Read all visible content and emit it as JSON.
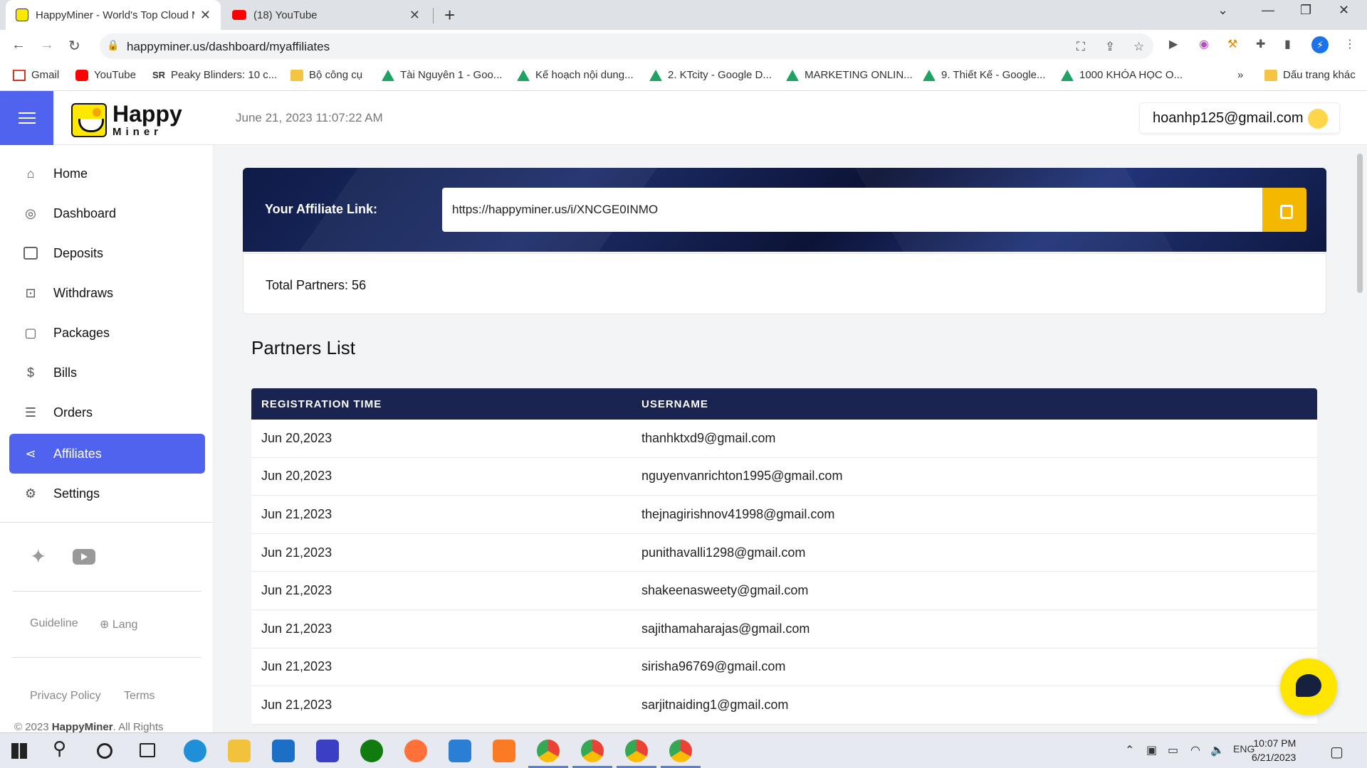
{
  "browser": {
    "tabs": [
      {
        "title": "HappyMiner - World's Top Cloud Mining",
        "active": true
      },
      {
        "title": "(18) YouTube",
        "active": false
      }
    ],
    "url": "happyminer.us/dashboard/myaffiliates",
    "bookmarks": [
      "Gmail",
      "YouTube",
      "Peaky Blinders: 10 c...",
      "Bộ công cụ",
      "Tài Nguyên 1 - Goo...",
      "Kế hoạch nội dung...",
      "2. KTcity - Google D...",
      "MARKETING ONLIN...",
      "9. Thiết Kế - Google...",
      "1000 KHÓA HỌC O...",
      "Dấu trang khác"
    ],
    "bookmarks_more": "»"
  },
  "header": {
    "logo_line1": "Happy",
    "logo_line2": "Miner",
    "datetime": "June 21, 2023 11:07:22 AM",
    "user_email": "hoanhp125@gmail.com"
  },
  "sidebar": {
    "items": [
      {
        "label": "Home",
        "icon": "home-icon"
      },
      {
        "label": "Dashboard",
        "icon": "compass-icon"
      },
      {
        "label": "Deposits",
        "icon": "wallet-icon"
      },
      {
        "label": "Withdraws",
        "icon": "cash-icon"
      },
      {
        "label": "Packages",
        "icon": "bag-icon"
      },
      {
        "label": "Bills",
        "icon": "bill-icon"
      },
      {
        "label": "Orders",
        "icon": "orders-icon"
      },
      {
        "label": "Affiliates",
        "icon": "share-icon",
        "active": true
      },
      {
        "label": "Settings",
        "icon": "gear-icon"
      }
    ],
    "guideline": "Guideline",
    "lang": "Lang",
    "privacy": "Privacy Policy",
    "terms": "Terms",
    "copyright_prefix": "© 2023",
    "copyright_brand": "HappyMiner",
    "copyright_suffix": ". All Rights"
  },
  "affiliate": {
    "label": "Your Affiliate Link:",
    "link": "https://happyminer.us/i/XNCGE0INMO",
    "total_partners": "Total Partners: 56"
  },
  "partners": {
    "title": "Partners List",
    "columns": [
      "REGISTRATION TIME",
      "USERNAME"
    ],
    "rows": [
      [
        "Jun 20,2023",
        "thanhktxd9@gmail.com"
      ],
      [
        "Jun 20,2023",
        "nguyenvanrichton1995@gmail.com"
      ],
      [
        "Jun 21,2023",
        "thejnagirishnov41998@gmail.com"
      ],
      [
        "Jun 21,2023",
        "punithavalli1298@gmail.com"
      ],
      [
        "Jun 21,2023",
        "shakeenasweety@gmail.com"
      ],
      [
        "Jun 21,2023",
        "sajithamaharajas@gmail.com"
      ],
      [
        "Jun 21,2023",
        "sirisha96769@gmail.com"
      ],
      [
        "Jun 21,2023",
        "sarjitnaiding1@gmail.com"
      ]
    ]
  },
  "taskbar": {
    "lang": "ENG",
    "time": "10:07 PM",
    "date": "6/21/2023"
  },
  "colors": {
    "accent": "#4f63ef",
    "banner": "#0f1b47",
    "copy_button": "#f5b800",
    "table_header": "#1a2450"
  }
}
